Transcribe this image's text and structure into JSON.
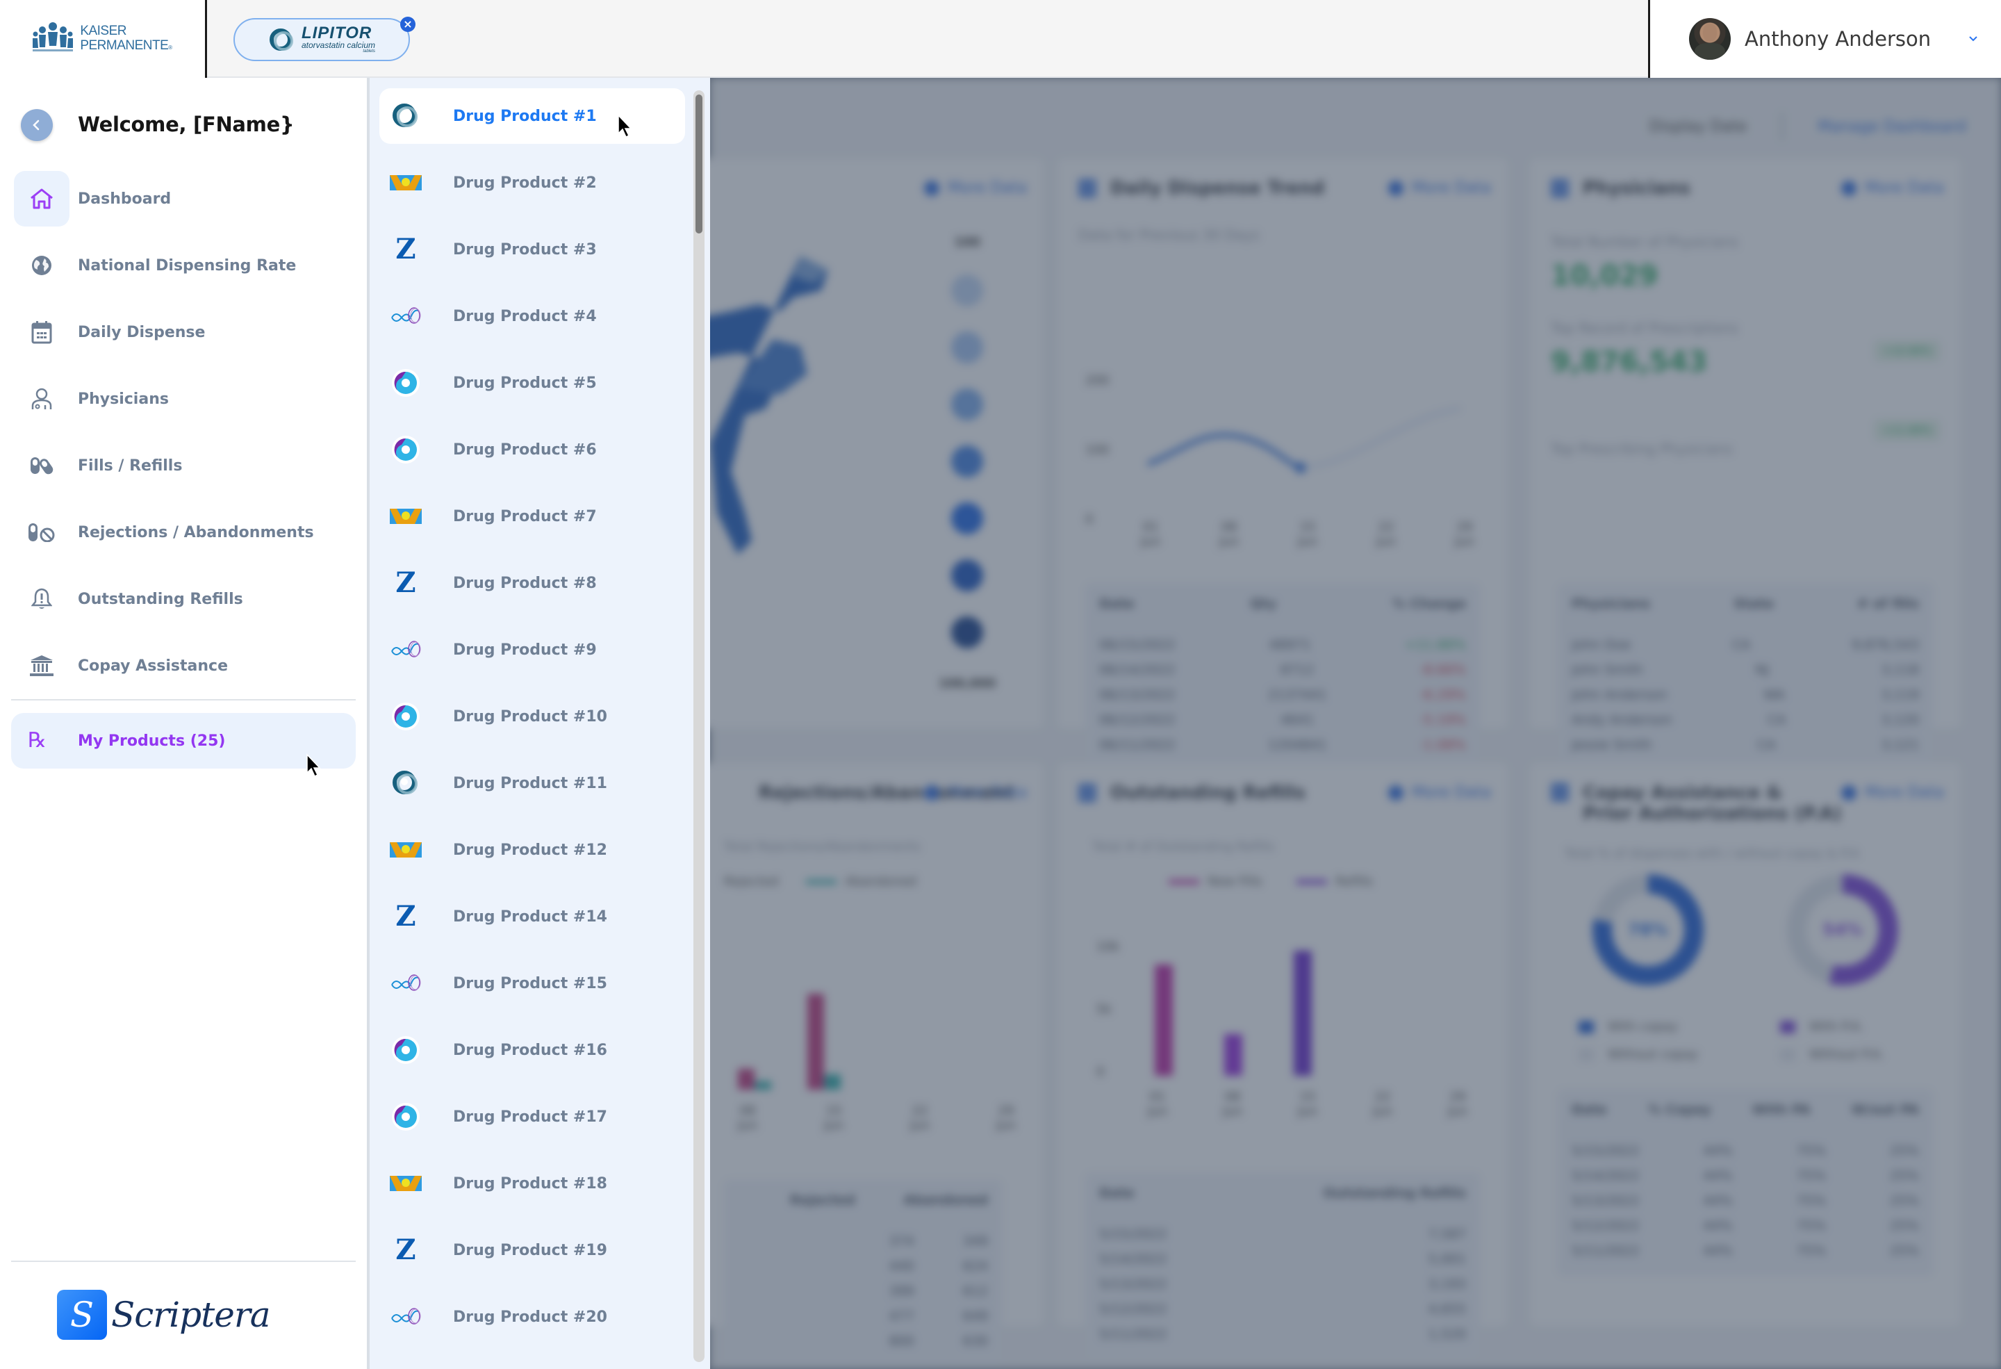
{
  "header": {
    "org_logo": {
      "line1": "KAISER",
      "line2": "PERMANENTE",
      "reg": "®"
    },
    "product_chip": {
      "brand": "LIPITOR",
      "generic": "atorvastatin calcium",
      "form": "tablets",
      "close_icon": "close-icon"
    },
    "user": {
      "name": "Anthony Anderson",
      "menu_icon": "chevron-down-icon"
    }
  },
  "sidebar": {
    "back_icon": "chevron-left-icon",
    "welcome": "Welcome, [FName}",
    "items": [
      {
        "label": "Dashboard",
        "icon": "home-icon",
        "active": true
      },
      {
        "label": "National Dispensing Rate",
        "icon": "globe-icon"
      },
      {
        "label": "Daily Dispense",
        "icon": "calendar-icon"
      },
      {
        "label": "Physicians",
        "icon": "physician-icon"
      },
      {
        "label": "Fills / Refills",
        "icon": "pills-icon"
      },
      {
        "label": "Rejections / Abandonments",
        "icon": "pill-blocked-icon"
      },
      {
        "label": "Outstanding Refills",
        "icon": "bell-alert-icon"
      },
      {
        "label": "Copay Assistance",
        "icon": "bank-icon"
      }
    ],
    "my_products": {
      "label": "My Products (25)",
      "icon": "rx-icon"
    },
    "footer_logo": {
      "badge": "S",
      "word": "Scriptera"
    }
  },
  "product_panel": {
    "selected_index": 0,
    "items": [
      {
        "label": "Drug Product #1",
        "logo": "rings"
      },
      {
        "label": "Drug Product #2",
        "logo": "sun-band"
      },
      {
        "label": "Drug Product #3",
        "logo": "z"
      },
      {
        "label": "Drug Product #4",
        "logo": "infinity"
      },
      {
        "label": "Drug Product #5",
        "logo": "swirl"
      },
      {
        "label": "Drug Product #6",
        "logo": "swirl"
      },
      {
        "label": "Drug Product #7",
        "logo": "sun-band"
      },
      {
        "label": "Drug Product #8",
        "logo": "z"
      },
      {
        "label": "Drug Product #9",
        "logo": "infinity"
      },
      {
        "label": "Drug Product #10",
        "logo": "swirl"
      },
      {
        "label": "Drug Product #11",
        "logo": "rings"
      },
      {
        "label": "Drug Product #12",
        "logo": "sun-band"
      },
      {
        "label": "Drug Product #14",
        "logo": "z"
      },
      {
        "label": "Drug Product #15",
        "logo": "infinity"
      },
      {
        "label": "Drug Product #16",
        "logo": "swirl"
      },
      {
        "label": "Drug Product #17",
        "logo": "swirl"
      },
      {
        "label": "Drug Product #18",
        "logo": "sun-band"
      },
      {
        "label": "Drug Product #19",
        "logo": "z"
      },
      {
        "label": "Drug Product #20",
        "logo": "infinity"
      }
    ]
  },
  "background_dashboard": {
    "topbar": {
      "display_date": "Display Date",
      "manage": "Manage Dashboard"
    },
    "more_data": "More Data",
    "map_card": {
      "legend_top": "100",
      "legend_bottom": "100,000"
    },
    "daily_trend": {
      "title": "Daily Dispense Trend",
      "subtitle": "Data for Previous 30 Days",
      "y_ticks": [
        "200",
        "100",
        "0"
      ],
      "x_ticks": [
        [
          "01",
          "Jun"
        ],
        [
          "08",
          "Jun"
        ],
        [
          "15",
          "Jun"
        ],
        [
          "22",
          "Jun"
        ],
        [
          "29",
          "Jun"
        ]
      ],
      "table": {
        "headers": [
          "Date",
          "Qty",
          "% Change"
        ],
        "rows": [
          [
            "06/15/2022",
            "48971",
            "+11.88%",
            "up"
          ],
          [
            "06/14/2022",
            "8712",
            "-8.66%",
            "down"
          ],
          [
            "06/13/2022",
            "2137441",
            "-6.29%",
            "down"
          ],
          [
            "06/12/2022",
            "4641",
            "-5.19%",
            "down"
          ],
          [
            "06/11/2022",
            "1204841",
            "-1.08%",
            "down"
          ]
        ]
      }
    },
    "physicians": {
      "title": "Physicians",
      "total_label": "Total Number of Physicians",
      "total_value": "10,029",
      "total_change": "+10.88%",
      "record_label": "Top Record of Prescriptions",
      "record_value": "9,876,543",
      "record_change": "+11.88%",
      "top_label": "Top Prescribing Physicians",
      "table": {
        "headers": [
          "Physicians",
          "State",
          "# of fills"
        ],
        "rows": [
          [
            "John Doe",
            "CA",
            "9,876,543"
          ],
          [
            "John Smith",
            "NJ",
            "3,118"
          ],
          [
            "John Anderson",
            "WA",
            "3,119"
          ],
          [
            "Andy Anderson",
            "CA",
            "3,120"
          ],
          [
            "Jessie Smith",
            "CA",
            "3,121"
          ]
        ]
      }
    },
    "rejections": {
      "title": "Rejections/Abandonment",
      "subtitle": "Total Rejections/Abandonments",
      "legend": [
        "Rejected",
        "Abandoned"
      ],
      "x_ticks": [
        [
          "08",
          "Jun"
        ],
        [
          "15",
          "Jun"
        ],
        [
          "22",
          "Jun"
        ],
        [
          "29",
          "Jun"
        ]
      ],
      "table": {
        "headers": [
          "Rejected",
          "Abandoned"
        ],
        "rows": [
          [
            "374",
            "349"
          ],
          [
            "440",
            "624"
          ],
          [
            "399",
            "612"
          ],
          [
            "477",
            "649"
          ],
          [
            "800",
            "630"
          ]
        ]
      }
    },
    "outstanding": {
      "title": "Outstanding Refills",
      "subtitle": "Total # of Outstanding Refills",
      "legend": [
        "New Fills",
        "Refills"
      ],
      "y_ticks": [
        "10k",
        "5k",
        "0"
      ],
      "x_ticks": [
        [
          "01",
          "Jun"
        ],
        [
          "08",
          "Jun"
        ],
        [
          "15",
          "Jun"
        ],
        [
          "22",
          "Jun"
        ],
        [
          "29",
          "Jun"
        ]
      ],
      "table": {
        "headers": [
          "Date",
          "Outstanding Refills"
        ],
        "rows": [
          [
            "5/15/2022",
            "7,587"
          ],
          [
            "5/14/2022",
            "5,001"
          ],
          [
            "5/13/2022",
            "3,193"
          ],
          [
            "5/12/2022",
            "4,655"
          ],
          [
            "5/11/2022",
            "1,520"
          ]
        ]
      }
    },
    "copay": {
      "title_line1": "Copay Assistance &",
      "title_line2": "Prior Authorizations (P.A)",
      "subtitle": "Total % of dispenses with / without copay & P.A",
      "donut1": {
        "value": "78%",
        "fraction": 0.78
      },
      "donut2": {
        "value": "54%",
        "fraction": 0.54
      },
      "legend1": [
        "With copay",
        "Without copay"
      ],
      "legend2": [
        "With P.A.",
        "Without P.A."
      ],
      "table": {
        "headers": [
          "Date",
          "% Copay",
          "With PA",
          "W/out PA"
        ],
        "rows": [
          [
            "5/15/2022",
            "44%",
            "75%",
            "25%"
          ],
          [
            "5/14/2022",
            "44%",
            "75%",
            "25%"
          ],
          [
            "5/13/2022",
            "44%",
            "75%",
            "25%"
          ],
          [
            "5/12/2022",
            "44%",
            "75%",
            "25%"
          ],
          [
            "5/11/2022",
            "44%",
            "75%",
            "25%"
          ]
        ]
      }
    }
  },
  "colors": {
    "accent_purple": "#9337f1",
    "selected_blue": "#1d79f2",
    "nav_text": "#6f7f94",
    "panel_bg": "#edf3fc",
    "overlay": "#717d8d"
  }
}
